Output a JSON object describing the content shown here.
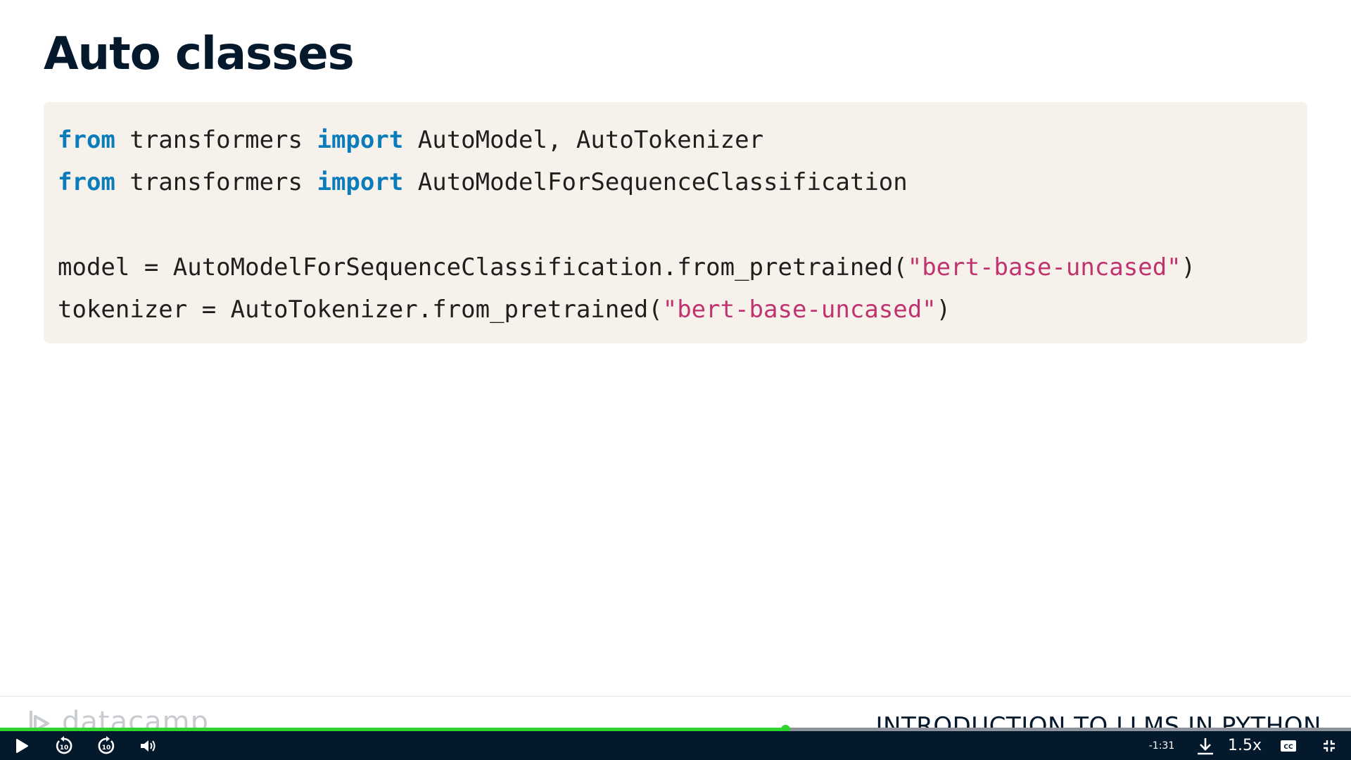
{
  "slide": {
    "title": "Auto classes",
    "code_lines": [
      [
        {
          "text": "from",
          "style": "kw"
        },
        {
          "text": " transformers ",
          "style": "plain"
        },
        {
          "text": "import",
          "style": "kw"
        },
        {
          "text": " AutoModel, AutoTokenizer",
          "style": "plain"
        }
      ],
      [
        {
          "text": "from",
          "style": "kw"
        },
        {
          "text": " transformers ",
          "style": "plain"
        },
        {
          "text": "import",
          "style": "kw"
        },
        {
          "text": " AutoModelForSequenceClassification",
          "style": "plain"
        }
      ],
      [],
      [
        {
          "text": "model = AutoModelForSequenceClassification.from_pretrained(",
          "style": "plain"
        },
        {
          "text": "\"bert-base-uncased\"",
          "style": "str"
        },
        {
          "text": ")",
          "style": "plain"
        }
      ],
      [
        {
          "text": "tokenizer = AutoTokenizer.from_pretrained(",
          "style": "plain"
        },
        {
          "text": "\"bert-base-uncased\"",
          "style": "str"
        },
        {
          "text": ")",
          "style": "plain"
        }
      ]
    ],
    "footer": {
      "logo_text": "datacamp",
      "course_title": "INTRODUCTION TO LLMS IN PYTHON"
    }
  },
  "player": {
    "progress_fraction": 0.581,
    "time_remaining": "-1:31",
    "playback_speed": "1.5x",
    "icons": {
      "play": "play-icon",
      "rewind": "rewind-10-icon",
      "forward": "forward-10-icon",
      "volume": "volume-icon",
      "download": "download-icon",
      "captions": "captions-icon",
      "exit_fullscreen": "exit-fullscreen-icon"
    }
  },
  "colors": {
    "keyword": "#0a7bbb",
    "string": "#c0336f",
    "title": "#05192d",
    "code_bg": "#f6f2eb",
    "progress": "#2fd42f",
    "control_bar": "#05192d"
  }
}
